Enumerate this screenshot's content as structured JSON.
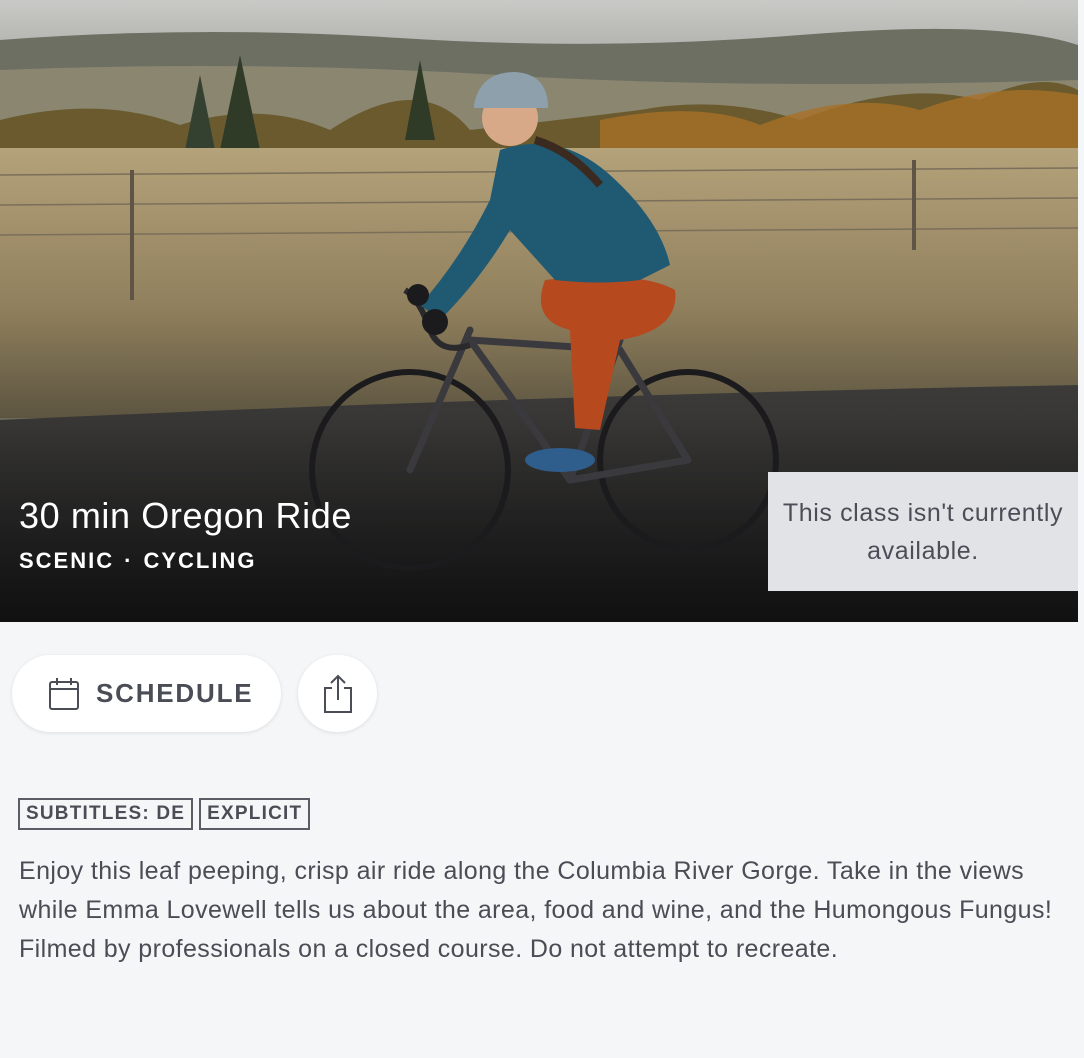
{
  "class": {
    "title": "30 min Oregon Ride",
    "category": "SCENIC",
    "separator": "·",
    "discipline": "CYCLING",
    "availability_message": "This class isn't currently available."
  },
  "actions": {
    "schedule_label": "SCHEDULE",
    "schedule_icon": "calendar-icon",
    "share_icon": "share-icon"
  },
  "tags": [
    "SUBTITLES: DE",
    "EXPLICIT"
  ],
  "description": "Enjoy this leaf peeping, crisp air ride along the Columbia River Gorge. Take in the views while Emma Lovewell tells us about the area, food and wine, and the Humongous Fungus! Filmed by professionals on a closed course. Do not attempt to recreate.",
  "colors": {
    "background": "#f5f6f8",
    "text": "#4a4d55",
    "banner_bg": "#e2e3e7"
  }
}
